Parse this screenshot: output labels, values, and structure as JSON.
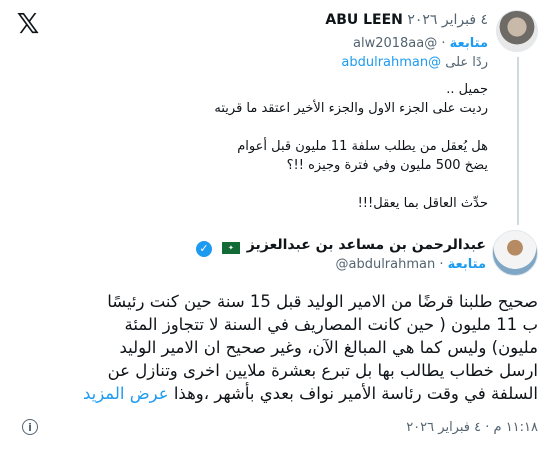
{
  "brand": {
    "logo_glyph": "𝕏"
  },
  "parent_tweet": {
    "author_name": "ABU LEEN",
    "author_handle": "@alw2018aa",
    "date": "٤ فبراير ٢٠٢٦",
    "separator": "·",
    "follow_label": "متابعة",
    "reply_to_label": "ردًا على",
    "reply_to_handle": "@abdulrahman",
    "lines": [
      "جميل ..",
      "رديت على الجزء الاول والجزء الأخير اعتقد ما قريته",
      "",
      "هل يُعقل من يطلب سلفة 11 مليون قبل أعوام",
      "يضخ 500 مليون وفي فترة وجيزه !!؟",
      "",
      "حدِّث العاقل بما يعقل!!!"
    ]
  },
  "main_tweet": {
    "author_name": "عبدالرحمن بن مساعد بن عبدالعزيز",
    "author_handle": "@abdulrahman",
    "separator": "·",
    "follow_label": "متابعة",
    "lines": [
      "صحيح طلبنا قرضًا من الامير الوليد قبل 15 سنة حين كنت رئيسًا",
      "ب 11 مليون ( حين كانت المصاريف في السنة لا تتجاوز المئة",
      "مليون) وليس كما هي المبالغ الآن، وغير صحيح ان الامير الوليد",
      "ارسل خطاب يطالب بها بل تبرع بعشرة ملايين اخرى وتنازل عن",
      "السلفة في وقت رئاسة الأمير نواف بعدي بأشهر ،وهذا"
    ],
    "show_more_label": "عرض المزيد",
    "timestamp": "١١:١٨ م · ٤ فبراير ٢٠٢٦"
  },
  "icons": {
    "verified": "verified-check-icon",
    "flag": "saudi-flag-icon",
    "info": "info-icon",
    "logo": "x-logo-icon"
  },
  "colors": {
    "link": "#1d9bf0",
    "muted": "#536471",
    "text": "#0f1419",
    "verified": "#1d9bf0"
  }
}
